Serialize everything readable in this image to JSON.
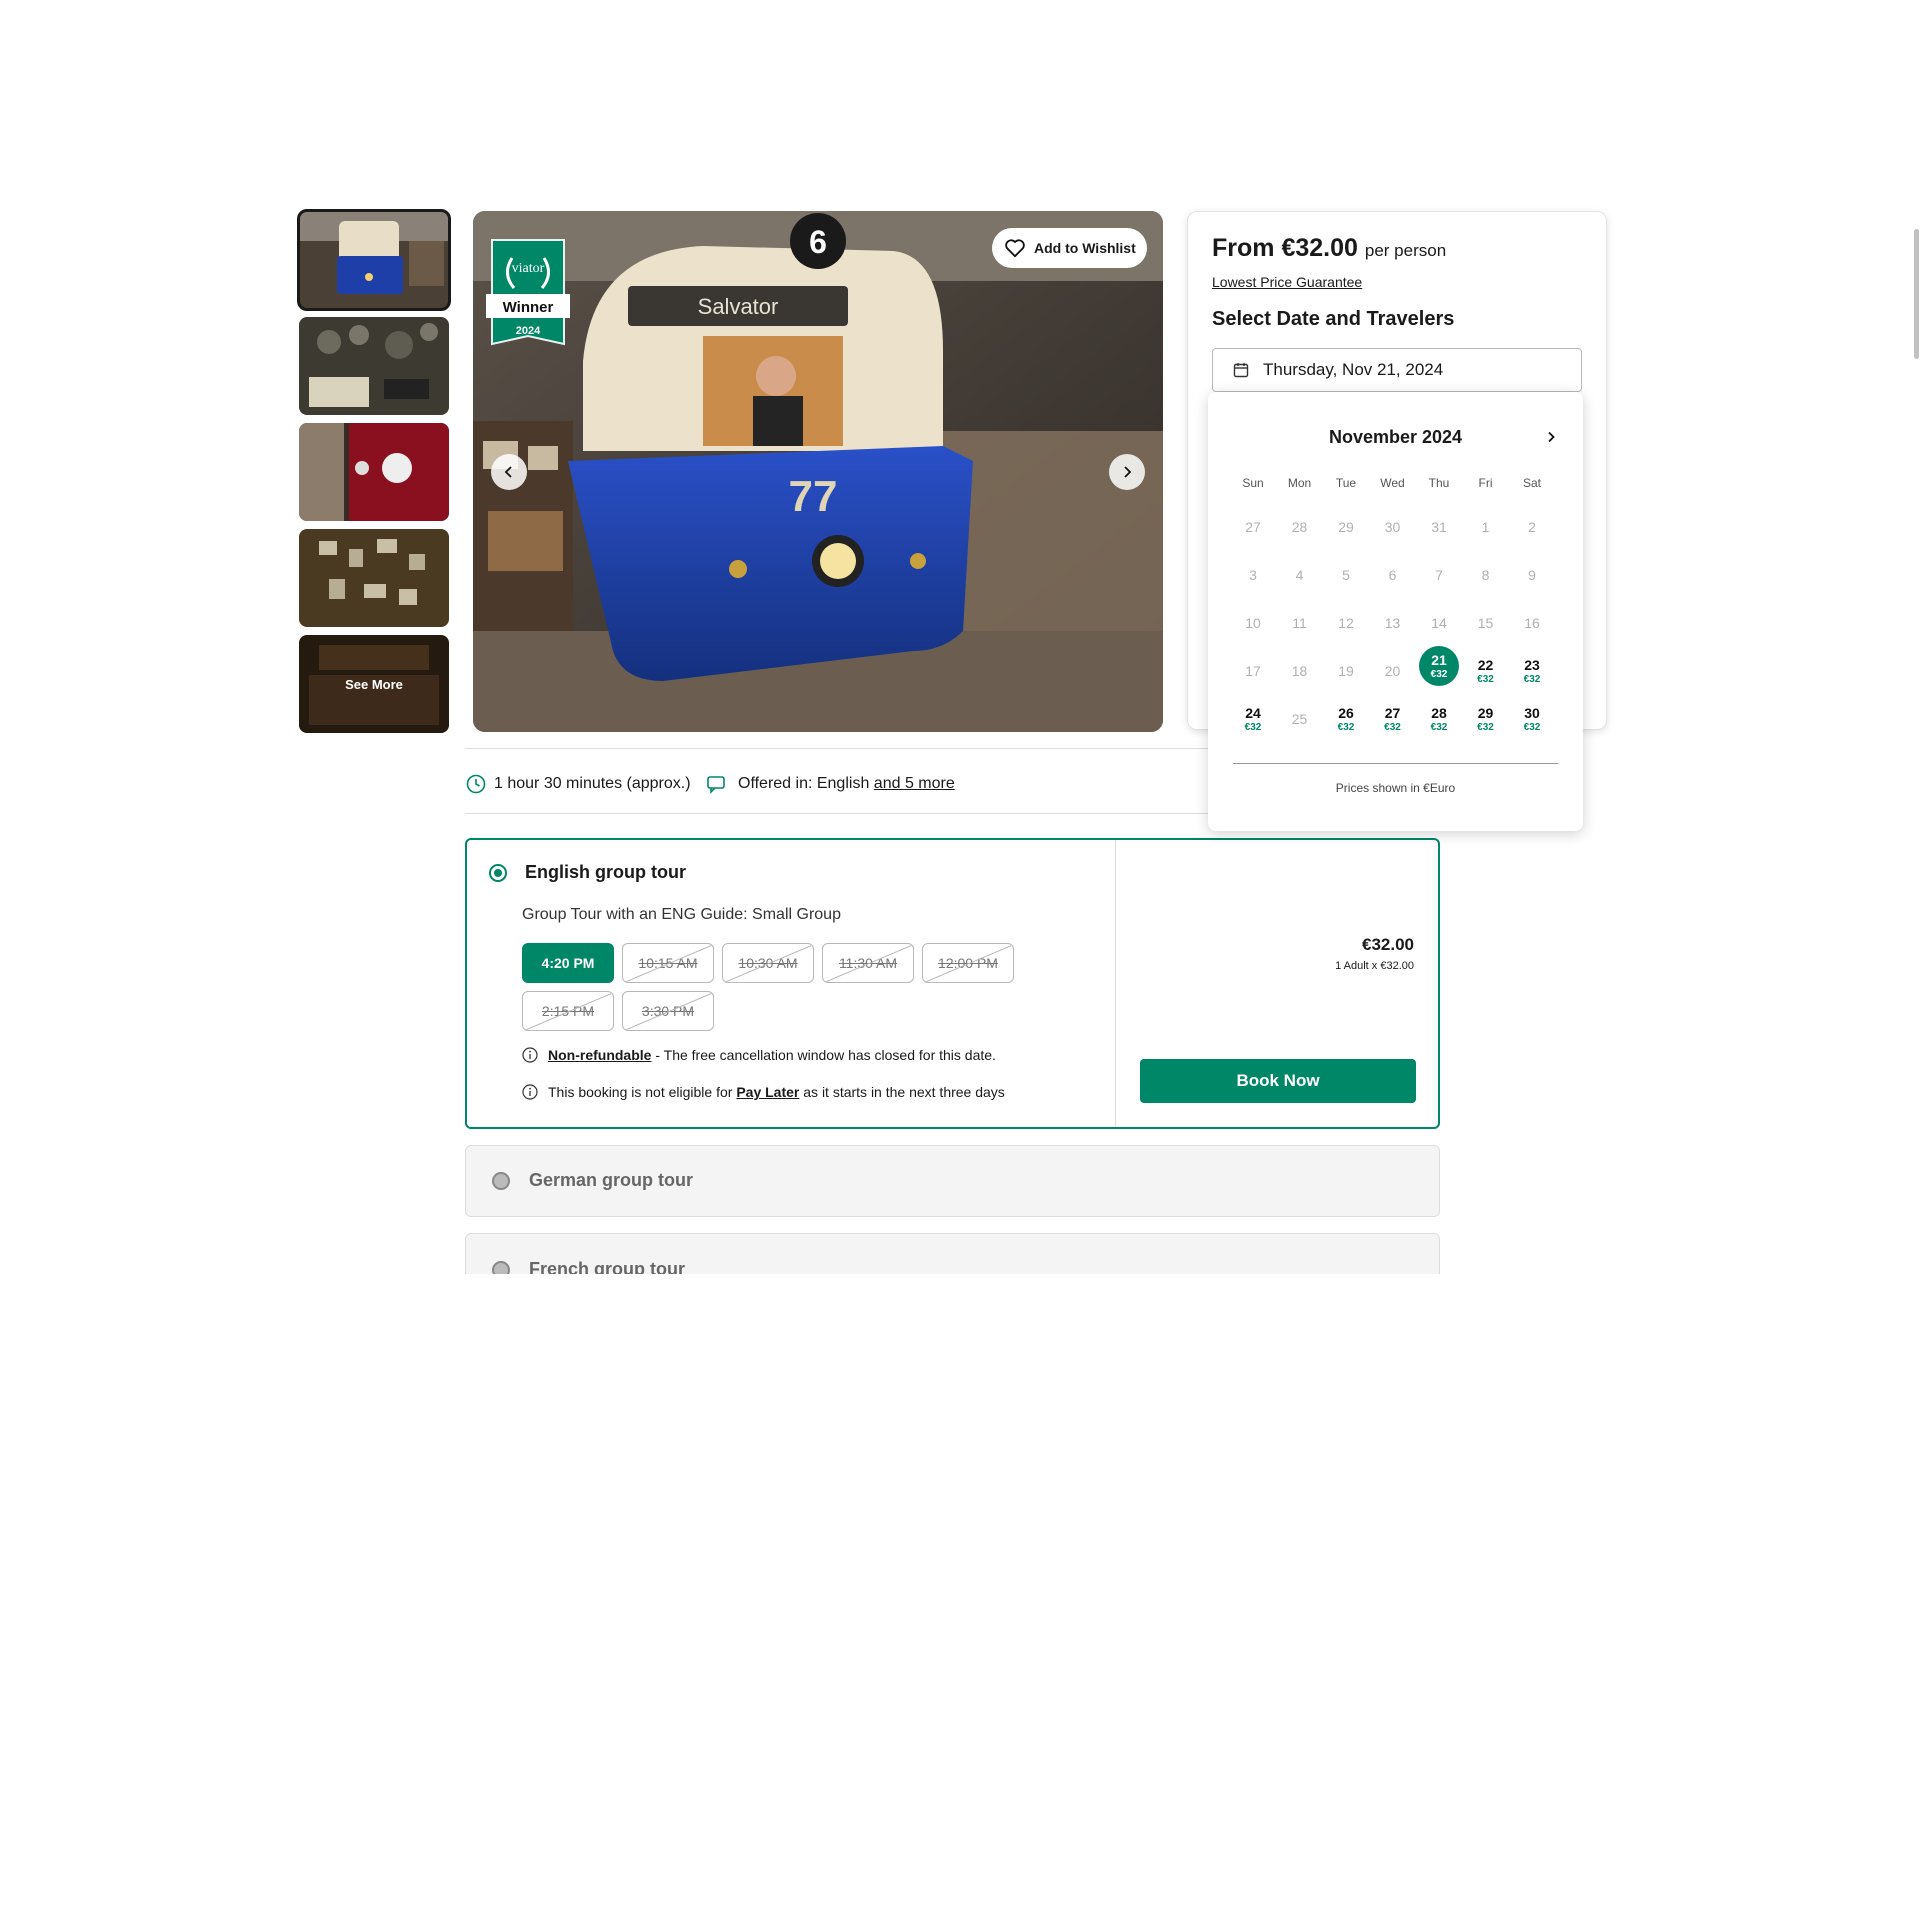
{
  "gallery": {
    "thumbnails": [
      "tram-exhibit",
      "radio-desk",
      "banner-room",
      "photo-wall",
      "archive-room"
    ],
    "see_more_label": "See More",
    "hero": {
      "wishlist_label": "Add to Wishlist",
      "badge": {
        "brand": "viator",
        "title": "Winner",
        "year": "2024"
      },
      "tram": {
        "destination": "Salvator",
        "route_number": "6",
        "car_number": "77"
      }
    }
  },
  "booking": {
    "price_prefix": "From €32.00",
    "price_suffix": "per person",
    "price_guarantee": "Lowest Price Guarantee",
    "select_title": "Select Date and Travelers",
    "date_value": "Thursday, Nov 21, 2024"
  },
  "calendar": {
    "month_label": "November 2024",
    "weekdays": [
      "Sun",
      "Mon",
      "Tue",
      "Wed",
      "Thu",
      "Fri",
      "Sat"
    ],
    "weeks": [
      [
        {
          "d": "27"
        },
        {
          "d": "28"
        },
        {
          "d": "29"
        },
        {
          "d": "30"
        },
        {
          "d": "31"
        },
        {
          "d": "1"
        },
        {
          "d": "2"
        }
      ],
      [
        {
          "d": "3"
        },
        {
          "d": "4"
        },
        {
          "d": "5"
        },
        {
          "d": "6"
        },
        {
          "d": "7"
        },
        {
          "d": "8"
        },
        {
          "d": "9"
        }
      ],
      [
        {
          "d": "10"
        },
        {
          "d": "11"
        },
        {
          "d": "12"
        },
        {
          "d": "13"
        },
        {
          "d": "14"
        },
        {
          "d": "15"
        },
        {
          "d": "16"
        }
      ],
      [
        {
          "d": "17"
        },
        {
          "d": "18"
        },
        {
          "d": "19"
        },
        {
          "d": "20"
        },
        {
          "d": "21",
          "p": "€32",
          "sel": true
        },
        {
          "d": "22",
          "p": "€32"
        },
        {
          "d": "23",
          "p": "€32"
        }
      ],
      [
        {
          "d": "24",
          "p": "€32"
        },
        {
          "d": "25"
        },
        {
          "d": "26",
          "p": "€32"
        },
        {
          "d": "27",
          "p": "€32"
        },
        {
          "d": "28",
          "p": "€32"
        },
        {
          "d": "29",
          "p": "€32"
        },
        {
          "d": "30",
          "p": "€32"
        }
      ]
    ],
    "footer_note": "Prices shown in €Euro"
  },
  "info": {
    "duration": "1 hour 30 minutes (approx.)",
    "offered_prefix": "Offered in: English",
    "offered_link": "and 5 more"
  },
  "options": {
    "active": {
      "title": "English group tour",
      "subtitle": "Group Tour with an ENG Guide: Small Group",
      "times": [
        {
          "label": "4:20 PM",
          "selected": true
        },
        {
          "label": "10:15 AM"
        },
        {
          "label": "10:30 AM"
        },
        {
          "label": "11:30 AM"
        },
        {
          "label": "12:00 PM"
        },
        {
          "label": "2:15 PM"
        },
        {
          "label": "3:30 PM"
        }
      ],
      "refund_link": "Non-refundable",
      "refund_text": " - The free cancellation window has closed for this date.",
      "paylater_before": "This booking is not eligible for ",
      "paylater_link": "Pay Later",
      "paylater_after": " as it starts in the next three days",
      "price": "€32.00",
      "price_detail": "1 Adult x €32.00",
      "book_label": "Book Now"
    },
    "others": [
      {
        "title": "German group tour"
      },
      {
        "title": "French group tour"
      }
    ]
  },
  "colors": {
    "accent": "#008768",
    "text": "#1a1a1a",
    "muted": "#b0b0b0"
  }
}
